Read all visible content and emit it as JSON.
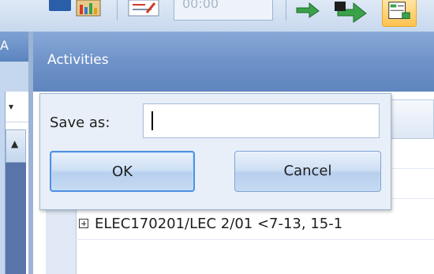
{
  "toolbar": {
    "field_text": "00:00"
  },
  "left_pane": {
    "header_letter": "A",
    "combo_arrow": "▾",
    "scroll_up_arrow": "▲"
  },
  "activities": {
    "title": "Activities",
    "rows": [
      {
        "text": ""
      },
      {
        "text": ""
      },
      {
        "text": "ELEC170201/LEC 2/01 <7-13, 15-1"
      }
    ]
  },
  "dialog": {
    "save_label": "Save as:",
    "input_value": "",
    "ok_label": "OK",
    "cancel_label": "Cancel"
  },
  "colors": {
    "header_blue": "#6f93c9",
    "active_tool": "#ffc24f",
    "ok_focus_border": "#4f8fe0"
  }
}
